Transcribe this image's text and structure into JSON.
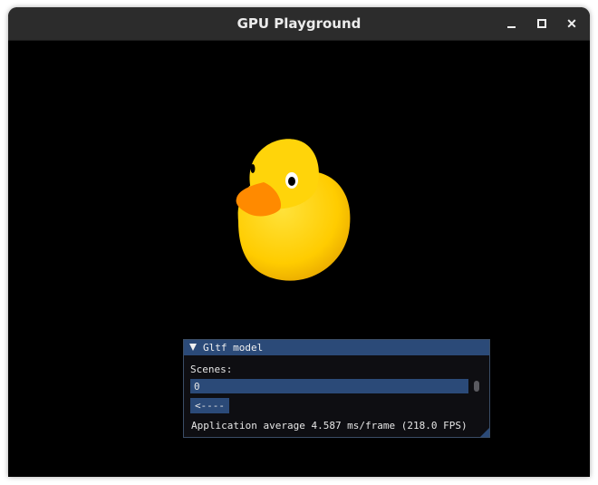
{
  "window": {
    "title": "GPU Playground"
  },
  "panel": {
    "title": "Gltf model",
    "scenes_label": "Scenes:",
    "scene_value": "0",
    "back_button": "<----",
    "status": "Application average 4.587 ms/frame (218.0 FPS)"
  },
  "colors": {
    "titlebar": "#2c2c2c",
    "viewport": "#000000",
    "panel_accent": "#2b4a78",
    "duck_body": "#ffcc00",
    "duck_beak": "#ff8a00"
  },
  "icons": {
    "minimize": "minimize-icon",
    "maximize": "maximize-icon",
    "close": "close-icon",
    "collapse": "triangle-down-icon"
  }
}
